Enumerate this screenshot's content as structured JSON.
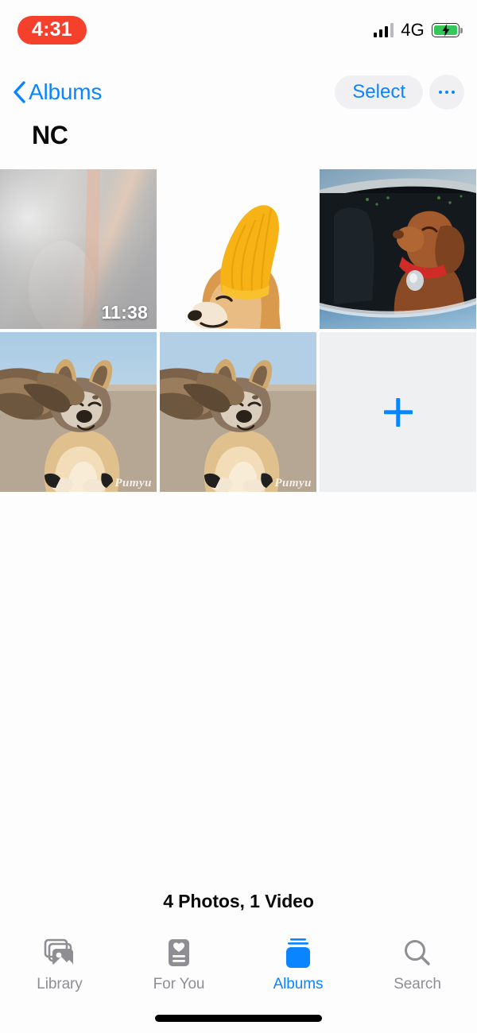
{
  "status_bar": {
    "time": "4:31",
    "time_pill_color": "#f5402c",
    "network": "4G",
    "signal_bars_filled": 3,
    "signal_bars_total": 4,
    "battery_charging": true,
    "battery_color": "#34c759"
  },
  "nav": {
    "back_label": "Albums",
    "select_label": "Select",
    "more_label": "•••",
    "accent_color": "#0a84ff"
  },
  "album": {
    "title": "NC",
    "count_text": "4 Photos, 1 Video"
  },
  "grid": {
    "tiles": [
      {
        "type": "video",
        "description": "gray blurred video thumbnail",
        "duration": "11:38",
        "watermark": ""
      },
      {
        "type": "photo",
        "description": "shiba inu wearing yellow knit beanie on white background",
        "duration": "",
        "watermark": ""
      },
      {
        "type": "photo",
        "description": "brown vizsla dog leaning out of car window",
        "duration": "",
        "watermark": ""
      },
      {
        "type": "photo",
        "description": "shiba inu with long flowing hair on beach",
        "duration": "",
        "watermark": "Pumyu"
      },
      {
        "type": "photo",
        "description": "shiba inu with long flowing hair on beach duplicate",
        "duration": "",
        "watermark": "Pumyu"
      },
      {
        "type": "add",
        "description": "add photos tile",
        "duration": "",
        "watermark": ""
      }
    ]
  },
  "tab_bar": {
    "active_index": 2,
    "items": [
      {
        "label": "Library",
        "icon": "photo-stack-icon"
      },
      {
        "label": "For You",
        "icon": "memories-card-icon"
      },
      {
        "label": "Albums",
        "icon": "albums-stack-icon"
      },
      {
        "label": "Search",
        "icon": "search-icon"
      }
    ]
  }
}
